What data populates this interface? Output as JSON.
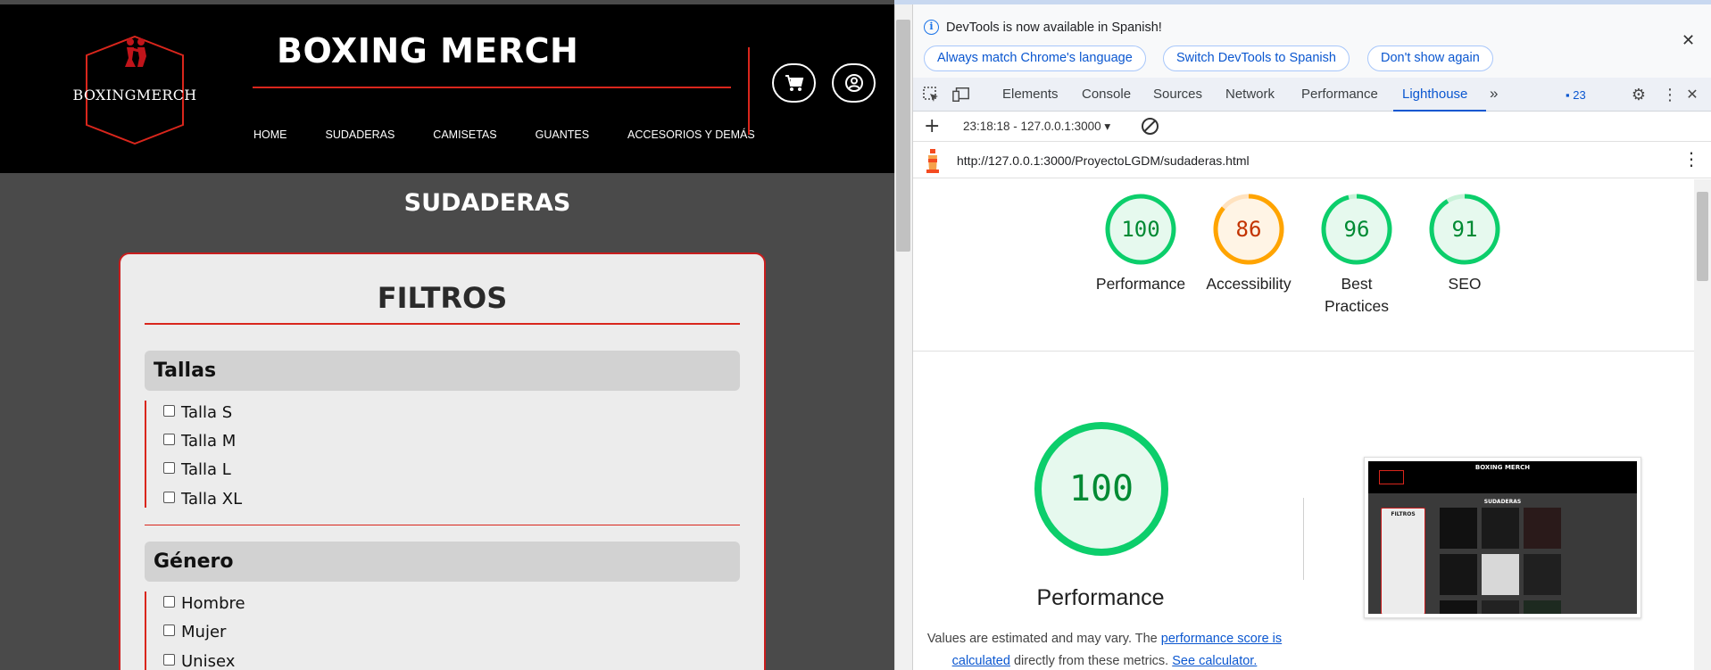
{
  "site": {
    "brand_title": "BOXING MERCH",
    "logo_text": "BOXINGMERCH",
    "nav": [
      "HOME",
      "SUDADERAS",
      "CAMISETAS",
      "GUANTES",
      "ACCESORIOS Y DEMÁS"
    ],
    "page_heading": "SUDADERAS",
    "filters": {
      "title": "FILTROS",
      "groups": [
        {
          "title": "Tallas",
          "options": [
            "Talla S",
            "Talla M",
            "Talla L",
            "Talla XL"
          ]
        },
        {
          "title": "Género",
          "options": [
            "Hombre",
            "Mujer",
            "Unisex"
          ]
        }
      ]
    },
    "colors": {
      "accent": "#d9261c",
      "header_bg": "#000000",
      "page_bg": "#4a4a4a"
    }
  },
  "devtools": {
    "infobar": {
      "text": "DevTools is now available in Spanish!",
      "buttons": [
        "Always match Chrome's language",
        "Switch DevTools to Spanish",
        "Don't show again"
      ]
    },
    "tabs": [
      "Elements",
      "Console",
      "Sources",
      "Network",
      "Performance",
      "Lighthouse"
    ],
    "active_tab": "Lighthouse",
    "issues_count": "23",
    "report_select": "23:18:18 - 127.0.0.1:3000 ▾",
    "report_url": "http://127.0.0.1:3000/ProyectoLGDM/sudaderas.html",
    "scores": [
      {
        "label": "Performance",
        "value": "100",
        "status": "pass"
      },
      {
        "label": "Accessibility",
        "value": "86",
        "status": "average"
      },
      {
        "label": "Best Practices",
        "value": "96",
        "status": "pass"
      },
      {
        "label": "SEO",
        "value": "91",
        "status": "pass"
      }
    ],
    "main_score": {
      "label": "Performance",
      "value": "100"
    },
    "note": {
      "before": "Values are estimated and may vary. The ",
      "link1": "performance score is calculated",
      "middle": " directly from these metrics. ",
      "link2": "See calculator."
    },
    "thumbnail": {
      "title": "BOXING MERCH",
      "heading": "SUDADERAS",
      "filters_title": "FILTROS"
    },
    "colors": {
      "pass": "#0cce6b",
      "average": "#ffa400",
      "link": "#0b57d0"
    }
  }
}
